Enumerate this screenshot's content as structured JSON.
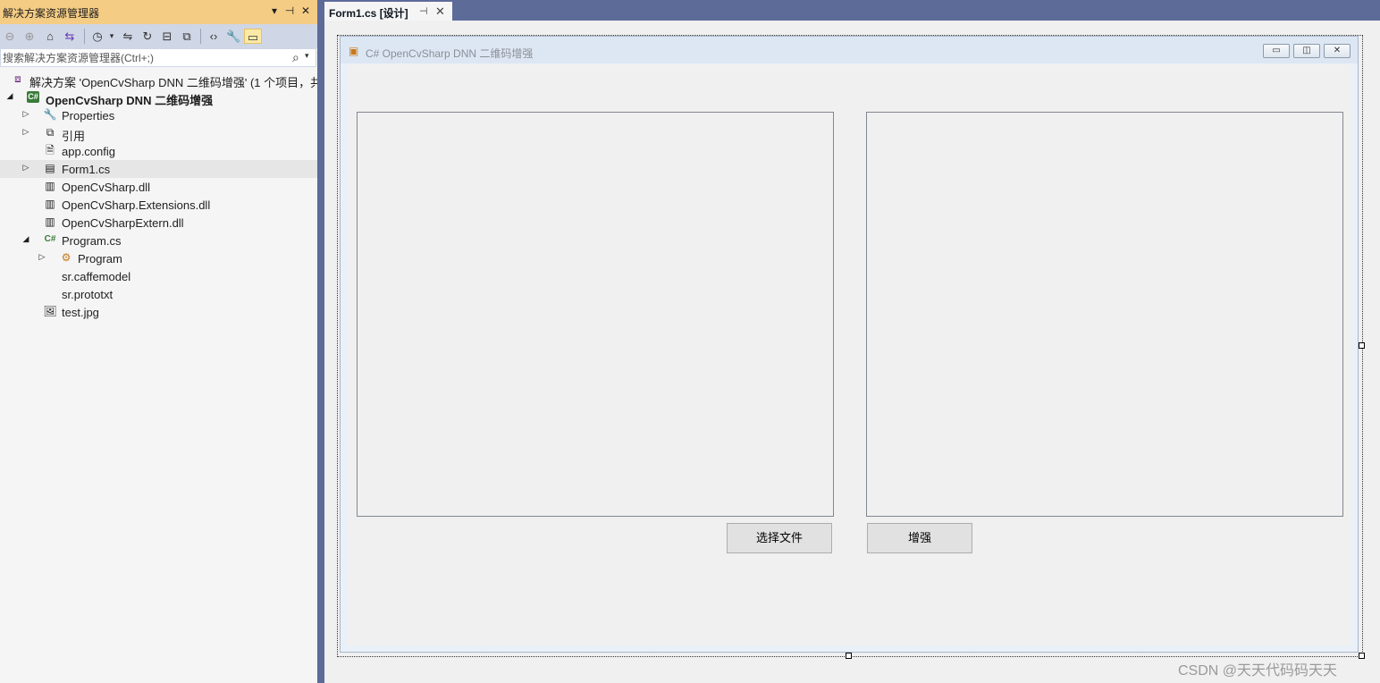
{
  "solution_explorer": {
    "title": "解决方案资源管理器",
    "title_buttons": [
      "▾",
      "⊣",
      "✕"
    ],
    "search_placeholder": "搜索解决方案资源管理器(Ctrl+;)",
    "tree": [
      {
        "label": "解决方案 'OpenCvSharp DNN 二维码增强' (1 个项目，共 1",
        "icon": "solution-icon",
        "expanded": null
      },
      {
        "label": "OpenCvSharp DNN 二维码增强",
        "icon": "csharp-project-icon",
        "expanded": true,
        "bold": true
      },
      {
        "label": "Properties",
        "icon": "wrench-icon",
        "expanded": false
      },
      {
        "label": "引用",
        "icon": "references-icon",
        "expanded": false
      },
      {
        "label": "app.config",
        "icon": "config-file-icon",
        "expanded": null
      },
      {
        "label": "Form1.cs",
        "icon": "form-icon",
        "expanded": false,
        "selected": true
      },
      {
        "label": "OpenCvSharp.dll",
        "icon": "library-icon",
        "expanded": null
      },
      {
        "label": "OpenCvSharp.Extensions.dll",
        "icon": "library-icon",
        "expanded": null
      },
      {
        "label": "OpenCvSharpExtern.dll",
        "icon": "library-icon",
        "expanded": null
      },
      {
        "label": "Program.cs",
        "icon": "csharp-file-icon",
        "expanded": true
      },
      {
        "label": "Program",
        "icon": "class-icon",
        "expanded": false
      },
      {
        "label": "sr.caffemodel",
        "icon": "file-icon",
        "expanded": null
      },
      {
        "label": "sr.prototxt",
        "icon": "file-icon",
        "expanded": null
      },
      {
        "label": "test.jpg",
        "icon": "image-icon",
        "expanded": null
      }
    ]
  },
  "editor": {
    "tab_label": "Form1.cs [设计]",
    "tab_pin": "⊣",
    "tab_close": "✕"
  },
  "form": {
    "title": "C# OpenCvSharp DNN 二维码增强",
    "select_file_button": "选择文件",
    "enhance_button": "增强"
  },
  "watermark": "CSDN @天天代码码天天",
  "colors": {
    "accent_title": "#f5cc84",
    "toolbar": "#cfd6e5",
    "frame": "#5d6b99",
    "selected_row": "#e6e6e6"
  }
}
